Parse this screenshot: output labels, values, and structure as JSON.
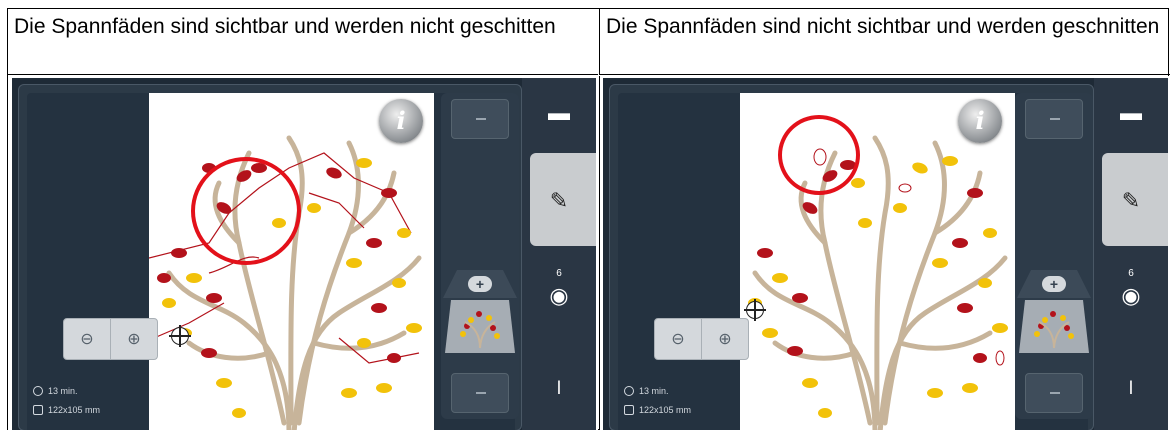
{
  "columns": [
    {
      "caption": "Die Spannfäden sind sichtbar und werden nicht geschitten",
      "screen": {
        "info_button": "i",
        "time": "13 min.",
        "size": "122x105 mm",
        "color_count": "6",
        "zoom_out_icon": "zoom-out-icon",
        "zoom_in_icon": "zoom-in-icon",
        "jump_threads_visible": true
      }
    },
    {
      "caption": "Die Spannfäden sind nicht sichtbar und werden geschnitten",
      "screen": {
        "info_button": "i",
        "time": "13 min.",
        "size": "122x105 mm",
        "color_count": "6",
        "zoom_out_icon": "zoom-out-icon",
        "zoom_in_icon": "zoom-in-icon",
        "jump_threads_visible": false
      }
    }
  ],
  "colors": {
    "highlight_circle": "#e3111a",
    "leaf_red": "#b3121b",
    "leaf_yellow": "#f2c20a",
    "trunk": "#c7b49a",
    "screen_bg": "#1e2a36"
  },
  "icons": [
    "folder-icon",
    "pencil-icon",
    "palette-icon",
    "needle-icon",
    "info-icon",
    "clock-icon",
    "size-icon",
    "crosshair-icon"
  ]
}
